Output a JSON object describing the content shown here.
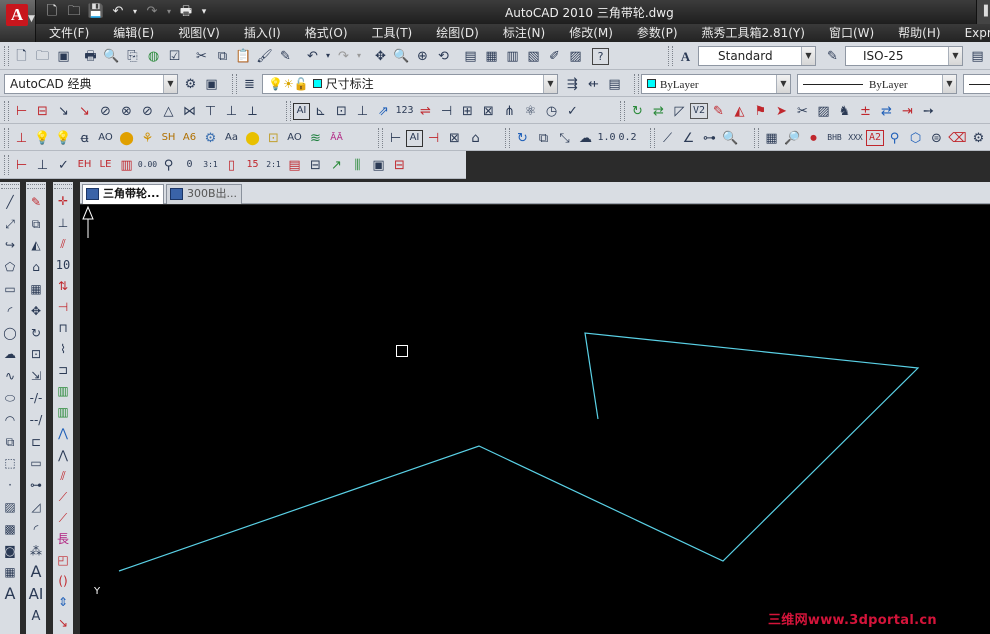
{
  "window": {
    "title": "AutoCAD 2010    三角带轮.dwg",
    "logo_letter": "A"
  },
  "quick_access": [
    "new-icon",
    "open-icon",
    "save-icon",
    "undo-icon",
    "redo-icon",
    "plot-icon"
  ],
  "menus": [
    "文件(F)",
    "编辑(E)",
    "视图(V)",
    "插入(I)",
    "格式(O)",
    "工具(T)",
    "绘图(D)",
    "标注(N)",
    "修改(M)",
    "参数(P)",
    "燕秀工具箱2.81(Y)",
    "窗口(W)",
    "帮助(H)",
    "Express"
  ],
  "toolbar": {
    "text_style": "Standard",
    "dim_style": "ISO-25",
    "workspace": "AutoCAD 经典",
    "layer": "尺寸标注",
    "color": "ByLayer",
    "linetype": "ByLayer",
    "labels": {
      "scale_1_0": "1.0",
      "scale_0_2": "0.2",
      "ratio_3_1": "3:1",
      "ratio_2_1": "2:1",
      "num_0": "0",
      "num_15": "15",
      "num_0_00": "0.00",
      "num_1_2_3": "123",
      "num_10": "10",
      "label_a2": "A2",
      "label_v2": "V2",
      "long": "長"
    }
  },
  "doc_tabs": [
    "三角带轮...",
    "300B出..."
  ],
  "canvas": {
    "background": "#000000",
    "line_color": "#5ad1e6",
    "ucs_label": "Y"
  },
  "watermark": "三维网www.3dportal.cn",
  "colors": {
    "accent_red": "#c8161d",
    "toolbar_bg": "#d9dde3",
    "title_bg": "#2b2b2b"
  }
}
